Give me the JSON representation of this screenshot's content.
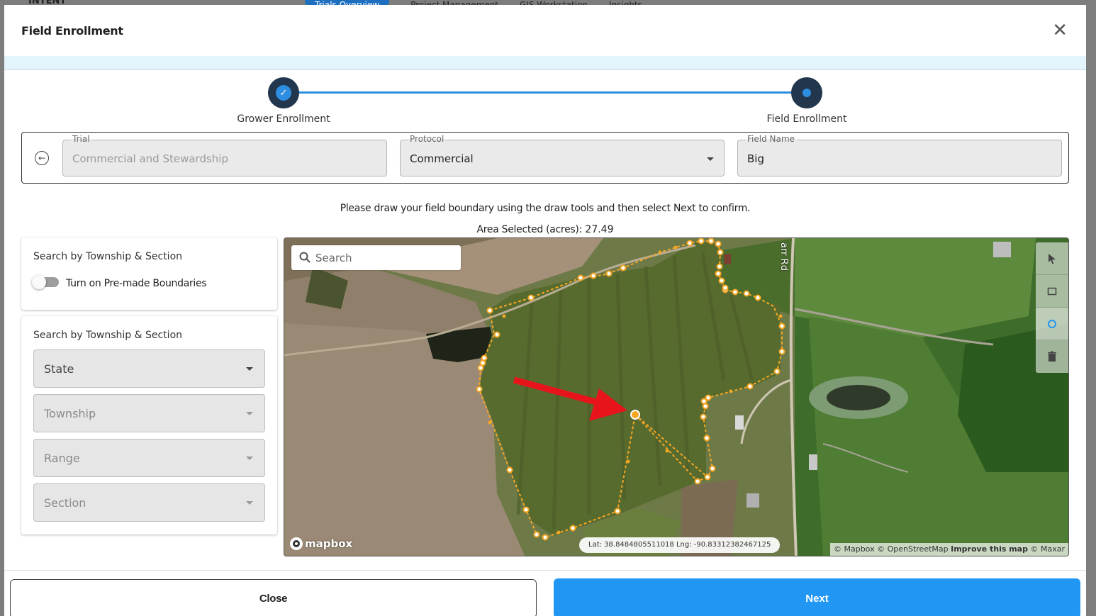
{
  "background": {
    "brand": "INTENT",
    "nav_tabs": [
      "Trials Overview",
      "Project Management",
      "GIS Workstation",
      "Insights"
    ]
  },
  "modal": {
    "title": "Field Enrollment",
    "close_icon": "close-icon"
  },
  "stepper": {
    "steps": [
      {
        "label": "Grower Enrollment",
        "state": "completed"
      },
      {
        "label": "Field Enrollment",
        "state": "active"
      }
    ],
    "accent": "#2d8de0",
    "dot_color": "#22364d"
  },
  "fields": {
    "trial": {
      "label": "Trial",
      "value": "Commercial and Stewardship"
    },
    "protocol": {
      "label": "Protocol",
      "value": "Commercial"
    },
    "field_name": {
      "label": "Field Name",
      "value": "Big"
    }
  },
  "instructions": "Please draw your field boundary using the draw tools and then select Next to confirm.",
  "area": {
    "label": "Area Selected (acres):",
    "value": "27.49"
  },
  "premade_panel": {
    "title": "Search by Township & Section",
    "toggle_label": "Turn on Pre-made Boundaries",
    "toggle_on": false
  },
  "township_panel": {
    "title": "Search by Township & Section",
    "selects": [
      {
        "placeholder": "State",
        "enabled": true
      },
      {
        "placeholder": "Township",
        "enabled": false
      },
      {
        "placeholder": "Range",
        "enabled": false
      },
      {
        "placeholder": "Section",
        "enabled": false
      }
    ]
  },
  "map": {
    "search_placeholder": "Search",
    "road_label": "arr Rd",
    "logo": "mapbox",
    "coordinates": "Lat: 38.8484805511018 Lng: -90.83312382467125",
    "attribution": {
      "mapbox": "© Mapbox",
      "osm": "© OpenStreetMap",
      "improve": "Improve this map",
      "maxar": "© Maxar"
    },
    "draw_tools": [
      "pointer-icon",
      "square-icon",
      "polygon-icon",
      "trash-icon"
    ],
    "boundary_color": "#f5a623",
    "arrow_color": "#e8141b"
  },
  "footer": {
    "close_label": "Close",
    "next_label": "Next",
    "next_color": "#2196f3"
  }
}
